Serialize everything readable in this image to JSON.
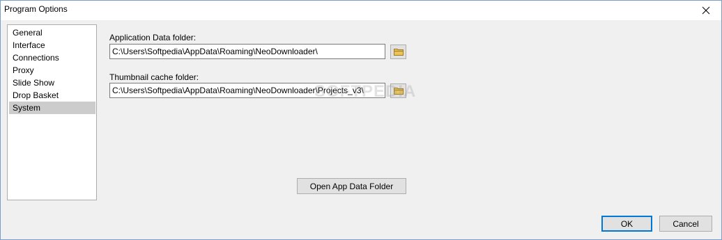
{
  "window": {
    "title": "Program Options"
  },
  "nav": {
    "items": [
      {
        "label": "General"
      },
      {
        "label": "Interface"
      },
      {
        "label": "Connections"
      },
      {
        "label": "Proxy"
      },
      {
        "label": "Slide Show"
      },
      {
        "label": "Drop Basket"
      },
      {
        "label": "System"
      }
    ],
    "selected": "System"
  },
  "system": {
    "app_data_label": "Application Data folder:",
    "app_data_value": "C:\\Users\\Softpedia\\AppData\\Roaming\\NeoDownloader\\",
    "thumb_cache_label": "Thumbnail cache folder:",
    "thumb_cache_value": "C:\\Users\\Softpedia\\AppData\\Roaming\\NeoDownloader\\Projects_v3\\",
    "open_app_data_label": "Open App Data Folder"
  },
  "footer": {
    "ok_label": "OK",
    "cancel_label": "Cancel"
  },
  "watermark": "SOFTPEDIA",
  "icons": {
    "close": "close-icon",
    "browse": "folder-icon"
  },
  "colors": {
    "selection": "#cccccc",
    "default_button_border": "#0078d7",
    "folder_icon": "#e8c45a"
  }
}
